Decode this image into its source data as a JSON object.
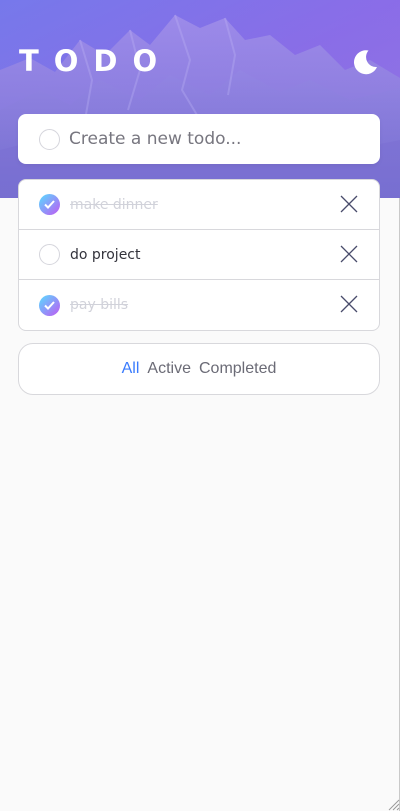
{
  "header": {
    "title": "TODO",
    "theme_icon": "moon-icon",
    "background_colors": [
      "#6d7be8",
      "#a36ddc"
    ]
  },
  "create": {
    "placeholder": "Create a new todo..."
  },
  "todos": [
    {
      "text": "make dinner",
      "completed": true
    },
    {
      "text": "do project",
      "completed": false
    },
    {
      "text": "pay bills",
      "completed": true
    }
  ],
  "filters": {
    "all": "All",
    "active": "Active",
    "completed": "Completed",
    "selected": "All"
  },
  "colors": {
    "accent": "#3a7bfd",
    "check_gradient": [
      "#57ddff",
      "#c058f3"
    ],
    "completed_text": "#d1d2da"
  }
}
